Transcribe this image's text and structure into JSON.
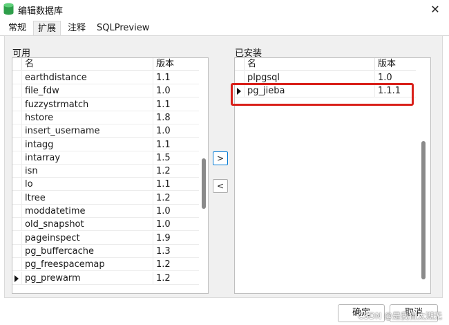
{
  "window": {
    "title": "编辑数据库",
    "close_glyph": "✕"
  },
  "tabs": [
    {
      "label": "常规",
      "active": false
    },
    {
      "label": "扩展",
      "active": true
    },
    {
      "label": "注释",
      "active": false
    },
    {
      "label": "SQLPreview",
      "active": false
    }
  ],
  "available": {
    "label": "可用",
    "columns": {
      "name": "名",
      "version": "版本"
    },
    "rows": [
      {
        "name": "earthdistance",
        "version": "1.1"
      },
      {
        "name": "file_fdw",
        "version": "1.0"
      },
      {
        "name": "fuzzystrmatch",
        "version": "1.1"
      },
      {
        "name": "hstore",
        "version": "1.8"
      },
      {
        "name": "insert_username",
        "version": "1.0"
      },
      {
        "name": "intagg",
        "version": "1.1"
      },
      {
        "name": "intarray",
        "version": "1.5"
      },
      {
        "name": "isn",
        "version": "1.2"
      },
      {
        "name": "lo",
        "version": "1.1"
      },
      {
        "name": "ltree",
        "version": "1.2"
      },
      {
        "name": "moddatetime",
        "version": "1.0"
      },
      {
        "name": "old_snapshot",
        "version": "1.0"
      },
      {
        "name": "pageinspect",
        "version": "1.9"
      },
      {
        "name": "pg_buffercache",
        "version": "1.3"
      },
      {
        "name": "pg_freespacemap",
        "version": "1.2"
      },
      {
        "name": "pg_prewarm",
        "version": "1.2",
        "current": true
      }
    ]
  },
  "installed": {
    "label": "已安装",
    "columns": {
      "name": "名",
      "version": "版本"
    },
    "rows": [
      {
        "name": "plpgsql",
        "version": "1.0"
      },
      {
        "name": "pg_jieba",
        "version": "1.1.1",
        "current": true
      }
    ]
  },
  "buttons": {
    "add": ">",
    "remove": "<",
    "ok": "确定",
    "cancel": "取消"
  },
  "watermark": "CSDN @是我自太湖无",
  "colors": {
    "highlight": "#d9201a",
    "accent": "#0078d4",
    "app_icon": "#2e9e4a"
  }
}
